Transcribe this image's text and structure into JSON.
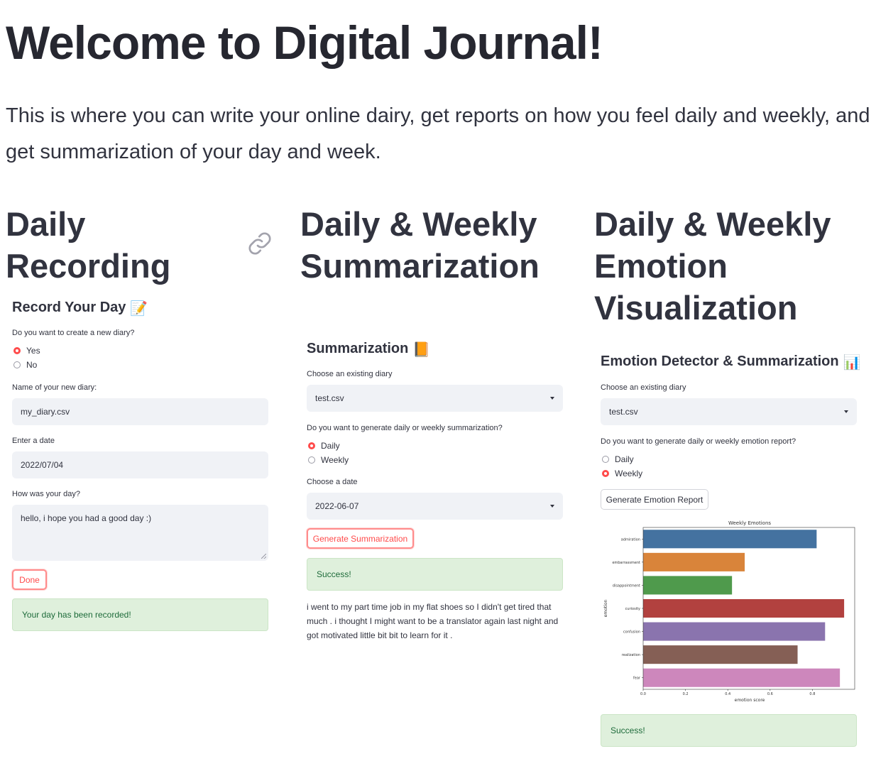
{
  "header": {
    "title": "Welcome to Digital Journal!",
    "intro": "This is where you can write your online dairy, get reports on how you feel daily and weekly, and get summarization of your day and week."
  },
  "columns": [
    {
      "title": "Daily Recording",
      "icon": "link-icon"
    },
    {
      "title": "Daily & Weekly Summarization"
    },
    {
      "title": "Daily & Weekly Emotion Visualization"
    }
  ],
  "record": {
    "title": "Record Your Day",
    "emoji": "📝",
    "create_question": "Do you want to create a new diary?",
    "options": [
      "Yes",
      "No"
    ],
    "selected": "Yes",
    "name_label": "Name of your new diary:",
    "name_value": "my_diary.csv",
    "date_label": "Enter a date",
    "date_value": "2022/07/04",
    "day_label": "How was your day?",
    "day_value": "hello, i hope you had a good day :)",
    "done_label": "Done",
    "success": "Your day has been recorded!"
  },
  "summary": {
    "title": "Summarization",
    "emoji": "📙",
    "diary_label": "Choose an existing diary",
    "diary_value": "test.csv",
    "period_question": "Do you want to generate daily or weekly summarization?",
    "options": [
      "Daily",
      "Weekly"
    ],
    "selected": "Daily",
    "date_label": "Choose a date",
    "date_value": "2022-06-07",
    "button_label": "Generate Summarization",
    "success": "Success!",
    "text": "i went to my part time job in my flat shoes so I didn't get tired that much . i thought I might want to be a translator again last night and got motivated little bit bit to learn for it ."
  },
  "emotion": {
    "title": "Emotion Detector & Summarization",
    "emoji": "📊",
    "diary_label": "Choose an existing diary",
    "diary_value": "test.csv",
    "period_question": "Do you want to generate daily or weekly emotion report?",
    "options": [
      "Daily",
      "Weekly"
    ],
    "selected": "Weekly",
    "button_label": "Generate Emotion Report",
    "success": "Success!"
  },
  "chart_data": {
    "type": "bar",
    "orientation": "horizontal",
    "title": "Weekly Emotions",
    "xlabel": "emotion score",
    "ylabel": "emotion",
    "categories": [
      "admiration",
      "embarrassment",
      "disappointment",
      "curiosity",
      "confusion",
      "realization",
      "fear"
    ],
    "values": [
      0.82,
      0.48,
      0.42,
      0.95,
      0.86,
      0.73,
      0.93
    ],
    "colors": [
      "#4472a0",
      "#d9843a",
      "#4f9a4c",
      "#b2413f",
      "#8a74ae",
      "#855f55",
      "#cd87bc"
    ],
    "xlim": [
      0,
      1.0
    ],
    "xticks": [
      0.0,
      0.2,
      0.4,
      0.6,
      0.8
    ],
    "grid": false
  }
}
